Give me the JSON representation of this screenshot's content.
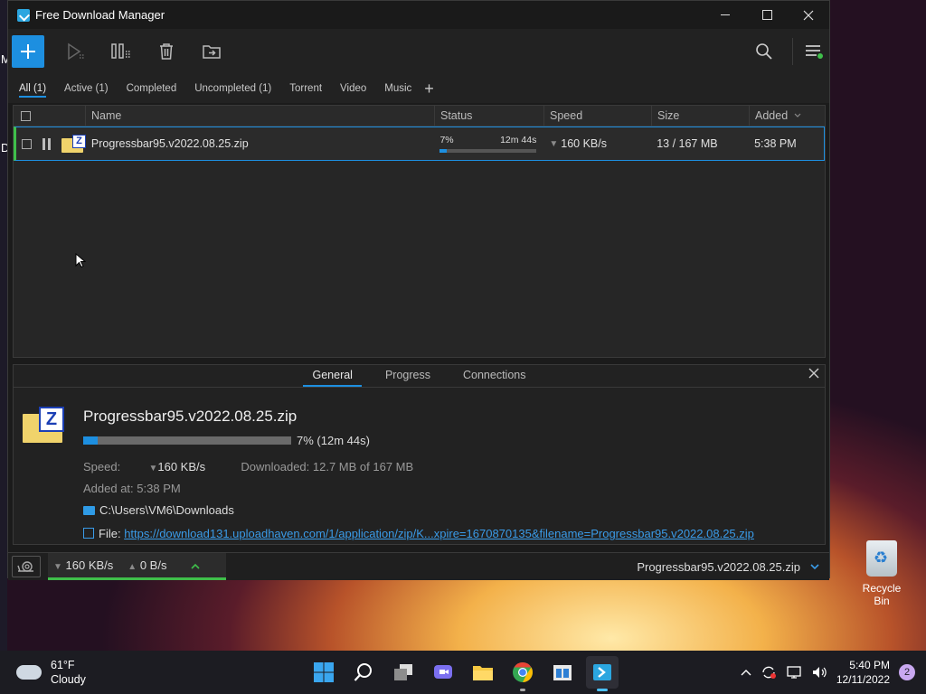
{
  "desktop": {
    "side_letters": [
      "M",
      "D"
    ]
  },
  "window": {
    "title": "Free Download Manager"
  },
  "filter_tabs": [
    "All (1)",
    "Active (1)",
    "Completed",
    "Uncompleted (1)",
    "Torrent",
    "Video",
    "Music"
  ],
  "list": {
    "columns": {
      "name": "Name",
      "status": "Status",
      "speed": "Speed",
      "size": "Size",
      "added": "Added"
    },
    "rows": [
      {
        "name": "Progressbar95.v2022.08.25.zip",
        "percent_label": "7%",
        "progress": 0.07,
        "time_left": "12m 44s",
        "speed": "160 KB/s",
        "size": "13 / 167 MB",
        "added": "5:38 PM"
      }
    ]
  },
  "details": {
    "tabs": [
      "General",
      "Progress",
      "Connections"
    ],
    "file_name": "Progressbar95.v2022.08.25.zip",
    "progress": 0.07,
    "progress_text": "7% (12m 44s)",
    "speed_label": "Speed:",
    "speed_value": "160 KB/s",
    "downloaded_label": "Downloaded:",
    "downloaded_value": "12.7 MB of 167 MB",
    "added_label": "Added at:",
    "added_value": "5:38 PM",
    "folder": "C:\\Users\\VM6\\Downloads",
    "file_label": "File:",
    "url": "https://download131.uploadhaven.com/1/application/zip/K...xpire=1670870135&filename=Progressbar95.v2022.08.25.zip"
  },
  "statusbar": {
    "down_speed": "160 KB/s",
    "up_speed": "0 B/s",
    "current_file": "Progressbar95.v2022.08.25.zip"
  },
  "desktop_icon": {
    "label": "Recycle Bin"
  },
  "taskbar": {
    "temperature": "61°F",
    "condition": "Cloudy",
    "time": "5:40 PM",
    "date": "12/11/2022",
    "notifications": "2"
  },
  "colors": {
    "accent": "#1d8fe0",
    "active_green": "#3fbf4a",
    "link": "#3a9be8"
  }
}
